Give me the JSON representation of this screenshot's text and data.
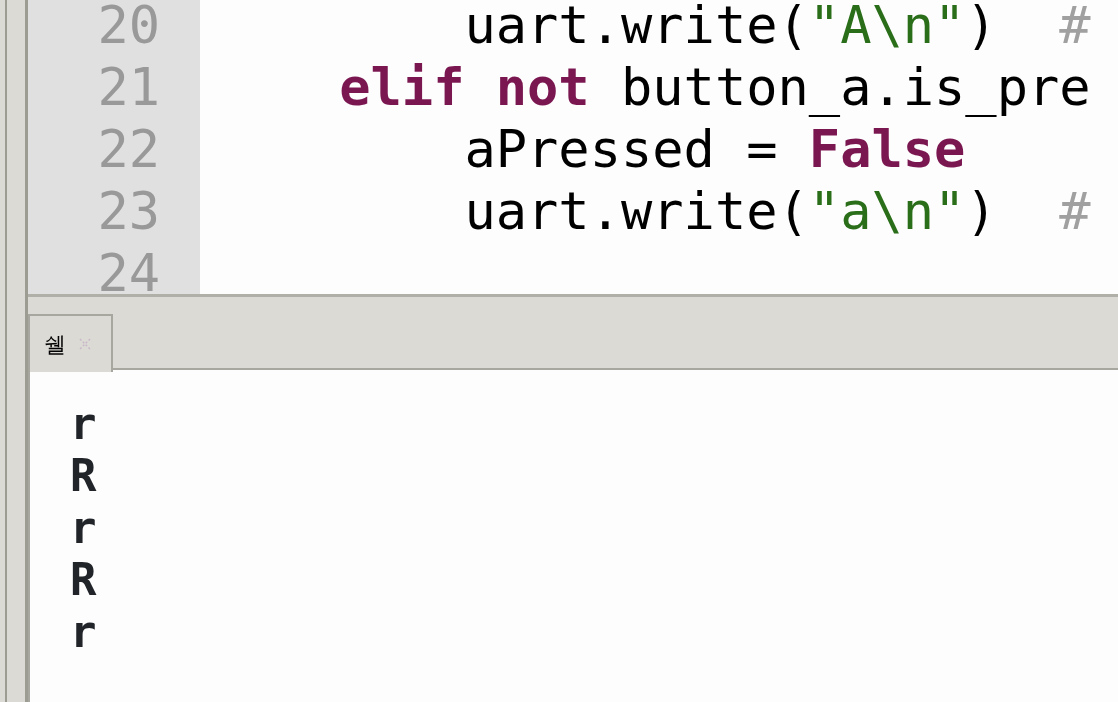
{
  "editor": {
    "lines": [
      {
        "number": "20",
        "tokens": [
          {
            "text": "        uart.write(",
            "kind": "plain"
          },
          {
            "text": "\"A\\n\"",
            "kind": "string"
          },
          {
            "text": ")  ",
            "kind": "plain"
          },
          {
            "text": "#",
            "kind": "comment"
          }
        ]
      },
      {
        "number": "21",
        "tokens": [
          {
            "text": "    elif",
            "kind": "keyword"
          },
          {
            "text": " not",
            "kind": "keyword"
          },
          {
            "text": " button_a.is_pre",
            "kind": "plain"
          }
        ]
      },
      {
        "number": "22",
        "tokens": [
          {
            "text": "        aPressed = ",
            "kind": "plain"
          },
          {
            "text": "False",
            "kind": "keyword"
          }
        ]
      },
      {
        "number": "23",
        "tokens": [
          {
            "text": "        uart.write(",
            "kind": "plain"
          },
          {
            "text": "\"a\\n\"",
            "kind": "string"
          },
          {
            "text": ")  ",
            "kind": "plain"
          },
          {
            "text": "#",
            "kind": "comment"
          }
        ]
      },
      {
        "number": "24"
      }
    ]
  },
  "shell": {
    "tabs": [
      {
        "label": "쉘",
        "selected": true
      }
    ],
    "output": [
      "r",
      "R",
      "r",
      "R",
      "r"
    ]
  }
}
